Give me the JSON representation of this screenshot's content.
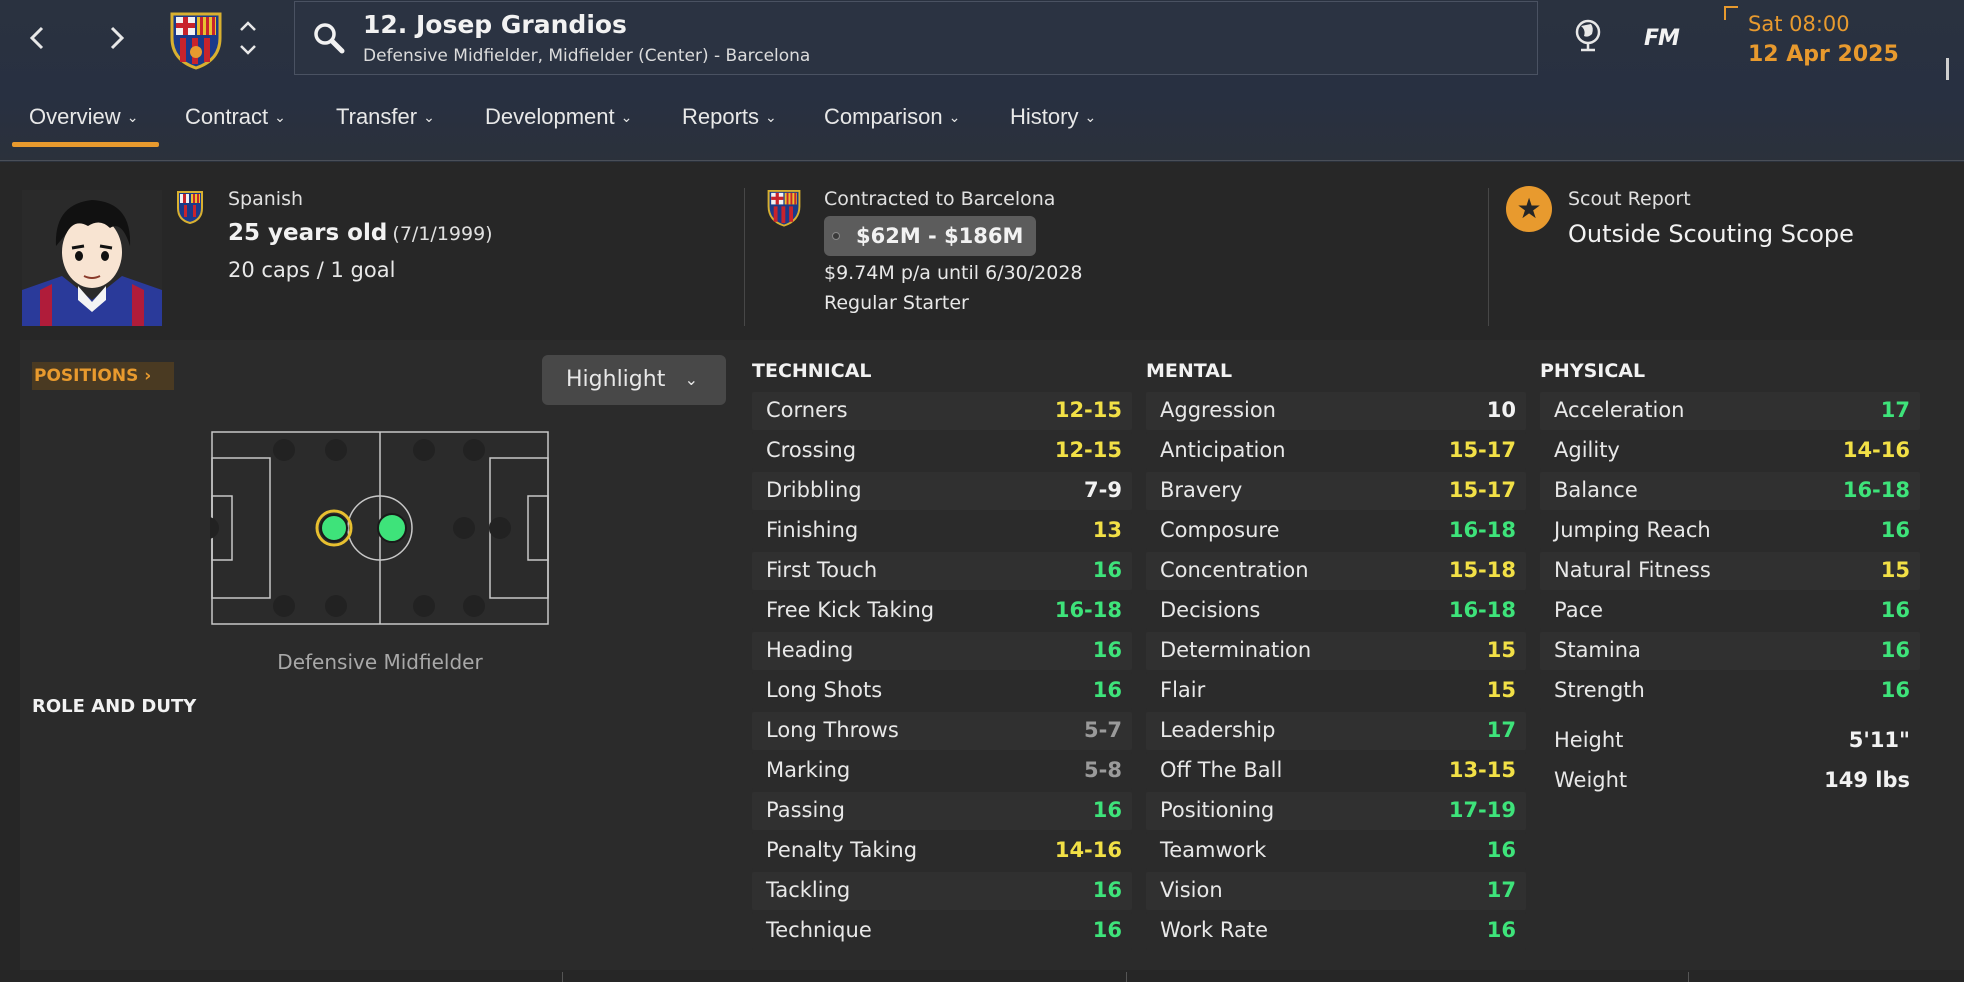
{
  "header": {
    "player_title": "12. Josep Grandios",
    "player_subtitle": "Defensive Midfielder, Midfielder (Center) - Barcelona",
    "brand": "FM",
    "date_day": "Sat 08:00",
    "date_full": "12 Apr 2025"
  },
  "tabs": [
    {
      "label": "Overview"
    },
    {
      "label": "Contract"
    },
    {
      "label": "Transfer"
    },
    {
      "label": "Development"
    },
    {
      "label": "Reports"
    },
    {
      "label": "Comparison"
    },
    {
      "label": "History"
    }
  ],
  "profile": {
    "nationality": "Spanish",
    "age": "25 years old",
    "dob": "(7/1/1999)",
    "caps": "20 caps / 1 goal"
  },
  "contract": {
    "club": "Contracted to Barcelona",
    "value_range": "$62M - $186M",
    "wage": "$9.74M p/a until 6/30/2028",
    "status": "Regular Starter"
  },
  "scout": {
    "label": "Scout Report",
    "value": "Outside Scouting Scope"
  },
  "positions": {
    "tag": "POSITIONS",
    "highlight": "Highlight",
    "caption": "Defensive Midfielder",
    "role_duty": "ROLE AND DUTY"
  },
  "technical": {
    "title": "TECHNICAL",
    "rows": [
      {
        "name": "Corners",
        "value": "12-15",
        "tone": "yellow"
      },
      {
        "name": "Crossing",
        "value": "12-15",
        "tone": "yellow"
      },
      {
        "name": "Dribbling",
        "value": "7-9",
        "tone": "white"
      },
      {
        "name": "Finishing",
        "value": "13",
        "tone": "yellow"
      },
      {
        "name": "First Touch",
        "value": "16",
        "tone": "green"
      },
      {
        "name": "Free Kick Taking",
        "value": "16-18",
        "tone": "green"
      },
      {
        "name": "Heading",
        "value": "16",
        "tone": "green"
      },
      {
        "name": "Long Shots",
        "value": "16",
        "tone": "green"
      },
      {
        "name": "Long Throws",
        "value": "5-7",
        "tone": "grey"
      },
      {
        "name": "Marking",
        "value": "5-8",
        "tone": "grey"
      },
      {
        "name": "Passing",
        "value": "16",
        "tone": "green"
      },
      {
        "name": "Penalty Taking",
        "value": "14-16",
        "tone": "yellow"
      },
      {
        "name": "Tackling",
        "value": "16",
        "tone": "green"
      },
      {
        "name": "Technique",
        "value": "16",
        "tone": "green"
      }
    ]
  },
  "mental": {
    "title": "MENTAL",
    "rows": [
      {
        "name": "Aggression",
        "value": "10",
        "tone": "white"
      },
      {
        "name": "Anticipation",
        "value": "15-17",
        "tone": "yellow"
      },
      {
        "name": "Bravery",
        "value": "15-17",
        "tone": "yellow"
      },
      {
        "name": "Composure",
        "value": "16-18",
        "tone": "green"
      },
      {
        "name": "Concentration",
        "value": "15-18",
        "tone": "yellow"
      },
      {
        "name": "Decisions",
        "value": "16-18",
        "tone": "green"
      },
      {
        "name": "Determination",
        "value": "15",
        "tone": "yellow"
      },
      {
        "name": "Flair",
        "value": "15",
        "tone": "yellow"
      },
      {
        "name": "Leadership",
        "value": "17",
        "tone": "green"
      },
      {
        "name": "Off The Ball",
        "value": "13-15",
        "tone": "yellow"
      },
      {
        "name": "Positioning",
        "value": "17-19",
        "tone": "green"
      },
      {
        "name": "Teamwork",
        "value": "16",
        "tone": "green"
      },
      {
        "name": "Vision",
        "value": "17",
        "tone": "green"
      },
      {
        "name": "Work Rate",
        "value": "16",
        "tone": "green"
      }
    ]
  },
  "physical": {
    "title": "PHYSICAL",
    "rows": [
      {
        "name": "Acceleration",
        "value": "17",
        "tone": "green"
      },
      {
        "name": "Agility",
        "value": "14-16",
        "tone": "yellow"
      },
      {
        "name": "Balance",
        "value": "16-18",
        "tone": "green"
      },
      {
        "name": "Jumping Reach",
        "value": "16",
        "tone": "green"
      },
      {
        "name": "Natural Fitness",
        "value": "15",
        "tone": "yellow"
      },
      {
        "name": "Pace",
        "value": "16",
        "tone": "green"
      },
      {
        "name": "Stamina",
        "value": "16",
        "tone": "green"
      },
      {
        "name": "Strength",
        "value": "16",
        "tone": "green"
      }
    ],
    "height_label": "Height",
    "height_value": "5'11\"",
    "weight_label": "Weight",
    "weight_value": "149 lbs"
  },
  "colors": {
    "accent": "#e89a2e",
    "green": "#3ee37a",
    "yellow": "#f2e046",
    "grey": "#9a9a9a"
  }
}
